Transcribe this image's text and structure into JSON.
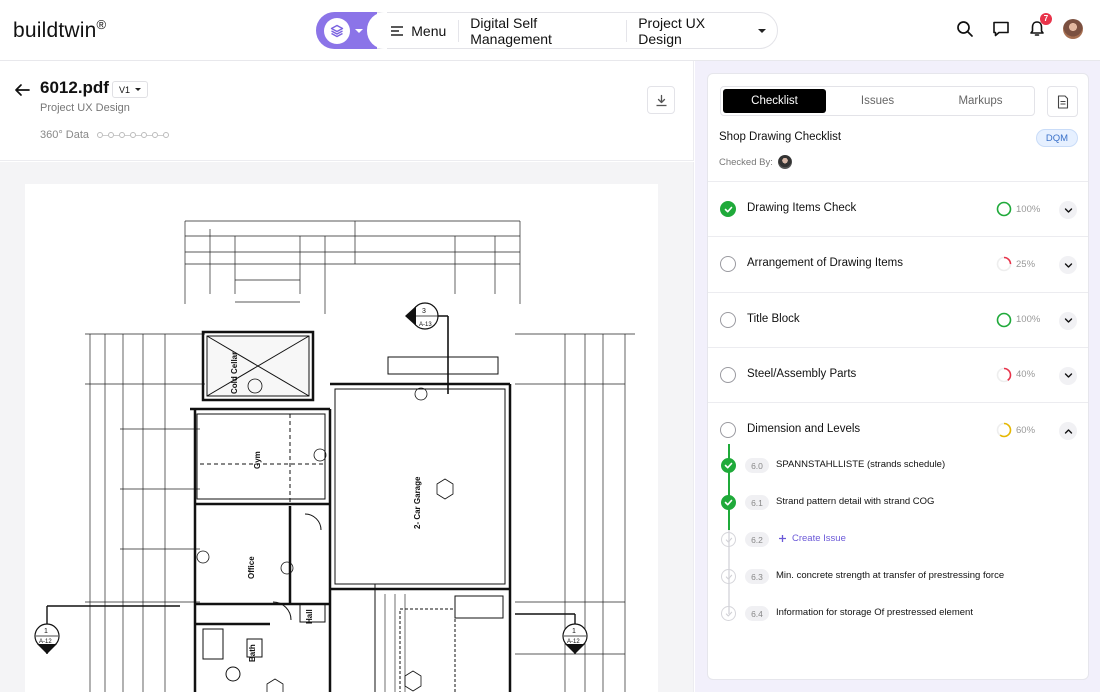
{
  "app": {
    "logo": "buildtwin",
    "logo_mark": "®"
  },
  "nav": {
    "menu_label": "Menu",
    "module": "Digital Self Management",
    "project": "Project UX Design",
    "notification_count": "7"
  },
  "document": {
    "title": "6012.pdf",
    "version": "V1",
    "project": "Project UX Design",
    "data_360_label": "360° Data"
  },
  "panel": {
    "tabs": [
      {
        "label": "Checklist",
        "active": true
      },
      {
        "label": "Issues",
        "active": false
      },
      {
        "label": "Markups",
        "active": false
      }
    ],
    "checklist_title": "Shop Drawing Checklist",
    "tag": "DQM",
    "checked_by_label": "Checked By:",
    "items": [
      {
        "label": "Drawing Items Check",
        "progress": "100%",
        "value": 1.0,
        "color": "#1faa3a",
        "done": true,
        "expanded": false
      },
      {
        "label": "Arrangement of Drawing Items",
        "progress": "25%",
        "value": 0.25,
        "color": "#e8334a",
        "done": false,
        "expanded": false
      },
      {
        "label": "Title Block",
        "progress": "100%",
        "value": 1.0,
        "color": "#1faa3a",
        "done": false,
        "expanded": false
      },
      {
        "label": "Steel/Assembly Parts",
        "progress": "40%",
        "value": 0.4,
        "color": "#e8334a",
        "done": false,
        "expanded": false
      },
      {
        "label": "Dimension and Levels",
        "progress": "60%",
        "value": 0.6,
        "color": "#e6b800",
        "done": false,
        "expanded": true
      }
    ],
    "subitems": [
      {
        "num": "6.0",
        "text": "SPANNSTAHLLISTE (strands schedule)",
        "done": true
      },
      {
        "num": "6.1",
        "text": "Strand pattern detail with strand COG",
        "done": true
      },
      {
        "num": "6.2",
        "text": "Create Issue",
        "done": false,
        "action": true
      },
      {
        "num": "6.3",
        "text": "Min. concrete strength at transfer of prestressing force",
        "done": false
      },
      {
        "num": "6.4",
        "text": "Information for storage Of prestressed element",
        "done": false
      }
    ]
  },
  "drawing": {
    "rooms": [
      "Cold Cellar",
      "Gym",
      "2- Car Garage",
      "Office",
      "Bath",
      "Hall"
    ],
    "section_marker": "A-13",
    "section_number": "3",
    "left_marker": "A-12",
    "left_marker_number": "1",
    "right_marker": "A-12",
    "right_marker_number": "1"
  }
}
